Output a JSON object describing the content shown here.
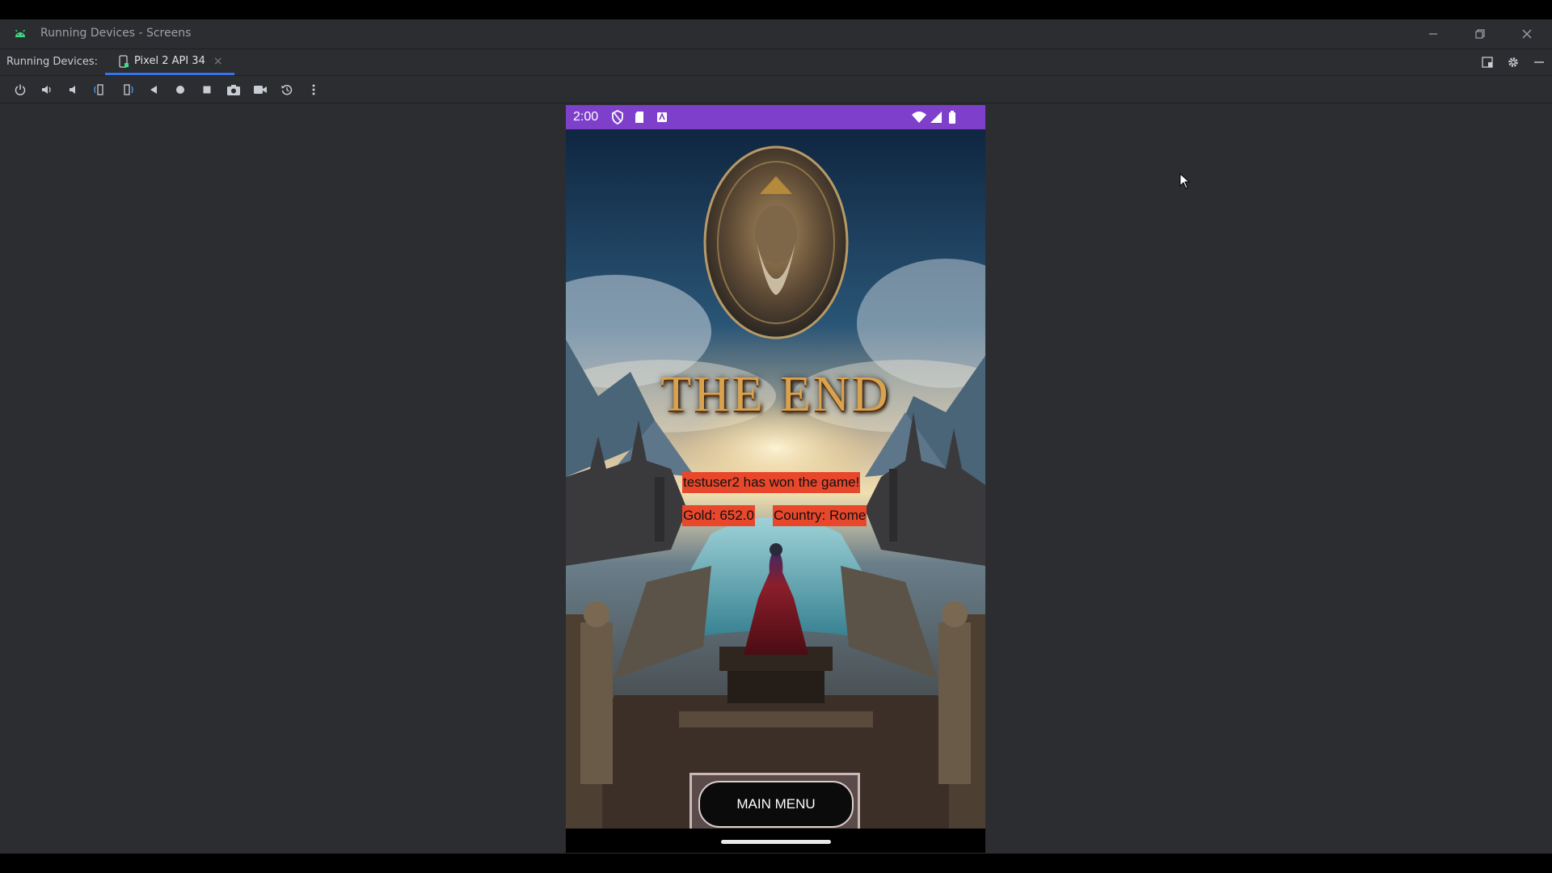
{
  "window": {
    "title": "Running Devices - Screens"
  },
  "tabs_bar": {
    "label": "Running Devices:",
    "tabs": [
      {
        "label": "Pixel 2 API 34",
        "close": "×",
        "icon": "device-icon"
      }
    ],
    "right_icons": [
      "layout-icon",
      "gear-icon",
      "minimize-icon"
    ]
  },
  "toolbar": {
    "buttons": [
      "power-icon",
      "volume-up-icon",
      "volume-down-icon",
      "rotate-left-icon",
      "rotate-right-icon",
      "back-icon",
      "home-icon",
      "overview-icon",
      "screenshot-icon",
      "record-icon",
      "reset-icon",
      "more-icon"
    ]
  },
  "device": {
    "status_bar": {
      "time": "2:00",
      "icons": [
        "shield-icon",
        "sd-card-icon",
        "keyboard-icon",
        "wifi-icon",
        "signal-icon",
        "battery-icon"
      ],
      "color": "#7e3fcb"
    },
    "game_screen": {
      "title": "THE END",
      "winner_text": "testuser2 has won the game!",
      "gold_text": "Gold: 652.0",
      "country_text": "Country: Rome",
      "main_menu_label": "MAIN MENU",
      "banner_color": "#e8472b"
    }
  }
}
